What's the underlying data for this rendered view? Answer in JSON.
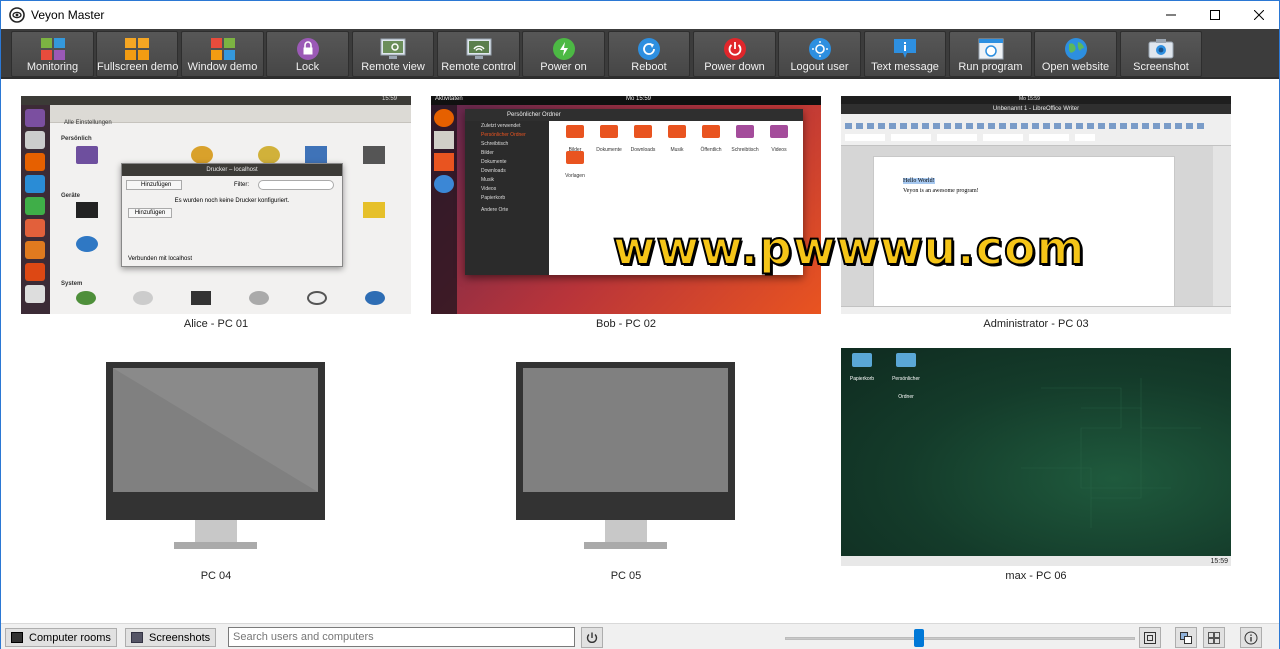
{
  "window": {
    "title": "Veyon Master"
  },
  "toolbar": {
    "buttons": [
      {
        "label": "Monitoring",
        "icon": "monitoring-icon",
        "color": "#6aa0d8"
      },
      {
        "label": "Fullscreen demo",
        "icon": "fullscreen-demo-icon",
        "color": "#f39c12"
      },
      {
        "label": "Window demo",
        "icon": "window-demo-icon",
        "color": "#e74c3c"
      },
      {
        "label": "Lock",
        "icon": "lock-icon",
        "color": "#9b59b6"
      },
      {
        "label": "Remote view",
        "icon": "remote-view-icon",
        "color": "#7f8c8d"
      },
      {
        "label": "Remote control",
        "icon": "remote-control-icon",
        "color": "#7f8c8d"
      },
      {
        "label": "Power on",
        "icon": "power-on-icon",
        "color": "#4cb944"
      },
      {
        "label": "Reboot",
        "icon": "reboot-icon",
        "color": "#2d8fe0"
      },
      {
        "label": "Power down",
        "icon": "power-down-icon",
        "color": "#e0262b"
      },
      {
        "label": "Logout user",
        "icon": "logout-user-icon",
        "color": "#2d8fe0"
      },
      {
        "label": "Text message",
        "icon": "text-message-icon",
        "color": "#2d8fe0"
      },
      {
        "label": "Run program",
        "icon": "run-program-icon",
        "color": "#dfe6ee"
      },
      {
        "label": "Open website",
        "icon": "open-website-icon",
        "color": "#2d8fe0"
      },
      {
        "label": "Screenshot",
        "icon": "screenshot-icon",
        "color": "#2d8fe0"
      }
    ]
  },
  "computers": [
    {
      "caption": "Alice - PC 01",
      "screen": "ubuntu-settings"
    },
    {
      "caption": "Bob - PC 02",
      "screen": "ubuntu-files"
    },
    {
      "caption": "Administrator - PC 03",
      "screen": "libreoffice-writer"
    },
    {
      "caption": "PC 04",
      "screen": "offline"
    },
    {
      "caption": "PC 05",
      "screen": "offline"
    },
    {
      "caption": "max - PC 06",
      "screen": "opensuse-desktop"
    }
  ],
  "screens": {
    "pc01": {
      "window_title": "Drucker – localhost",
      "add_button": "Hinzufügen",
      "filter_label": "Filter:",
      "message": "Es wurden noch keine Drucker konfiguriert.",
      "add_button_2": "Hinzufügen",
      "status": "Verbunden mit localhost",
      "section_personal": "Persönlich",
      "section_devices": "Geräte",
      "section_system": "System",
      "all_settings": "Alle Einstellungen",
      "clock": "15:59"
    },
    "pc02": {
      "activities": "Aktivitäten",
      "clock": "Mo 15:59",
      "window_title": "Persönlicher Ordner",
      "sidebar": [
        "Zuletzt verwendet",
        "Persönlicher Ordner",
        "Schreibtisch",
        "Bilder",
        "Dokumente",
        "Downloads",
        "Musik",
        "Videos",
        "Papierkorb",
        "Andere Orte"
      ],
      "folders": [
        "Bilder",
        "Dokumente",
        "Downloads",
        "Musik",
        "Öffentlich",
        "Schreibtisch",
        "Videos",
        "Vorlagen"
      ]
    },
    "pc03": {
      "document_title": "Unbenannt 1 - LibreOffice Writer",
      "clock": "Mo 15:59",
      "line1": "Hello World!",
      "line2": "Veyon is an awesome program!"
    },
    "pc06": {
      "icons": [
        "Papierkorb",
        "Persönlicher Ordner"
      ],
      "clock": "15:59"
    }
  },
  "watermark": "www.pwwwu.com",
  "statusbar": {
    "computer_rooms": "Computer rooms",
    "screenshots": "Screenshots",
    "search_placeholder": "Search users and computers",
    "zoom_level": 0.38
  }
}
